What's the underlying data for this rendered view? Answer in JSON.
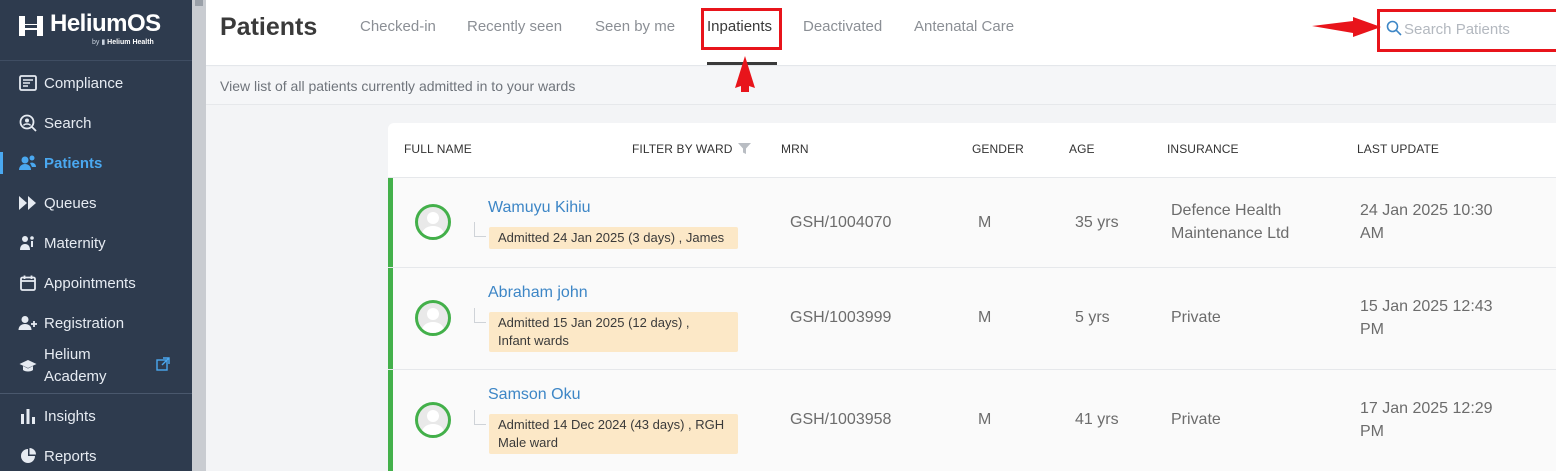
{
  "sidebar": {
    "brand": {
      "name": "HeliumOS",
      "sub_prefix": "by",
      "sub_brand": "Helium Health"
    },
    "items": [
      {
        "label": "Compliance",
        "icon": "compliance-icon"
      },
      {
        "label": "Search",
        "icon": "search-icon"
      },
      {
        "label": "Patients",
        "icon": "patients-icon",
        "active": true
      },
      {
        "label": "Queues",
        "icon": "queues-icon"
      },
      {
        "label": "Maternity",
        "icon": "maternity-icon"
      },
      {
        "label": "Appointments",
        "icon": "calendar-icon"
      },
      {
        "label": "Registration",
        "icon": "add-user-icon"
      },
      {
        "label": "Helium Academy",
        "label_line1": "Helium",
        "label_line2": "Academy",
        "icon": "graduation-cap-icon",
        "external_icon": "external-link-icon"
      },
      {
        "label": "Insights",
        "icon": "bar-chart-icon"
      },
      {
        "label": "Reports",
        "icon": "pie-chart-icon"
      }
    ]
  },
  "header": {
    "title": "Patients",
    "tabs": [
      {
        "label": "Checked-in"
      },
      {
        "label": "Recently seen"
      },
      {
        "label": "Seen by me"
      },
      {
        "label": "Inpatients",
        "active": true
      },
      {
        "label": "Deactivated"
      },
      {
        "label": "Antenatal Care"
      }
    ],
    "search": {
      "placeholder": "Search Patients",
      "value": ""
    }
  },
  "subheader": {
    "text": "View list of all patients currently admitted in to your wards"
  },
  "table": {
    "columns": {
      "full_name": "FULL NAME",
      "filter_by_ward": "FILTER BY WARD",
      "mrn": "MRN",
      "gender": "GENDER",
      "age": "AGE",
      "insurance": "INSURANCE",
      "last_update": "LAST UPDATE"
    },
    "rows": [
      {
        "name": "Wamuyu Kihiu",
        "admission": "Admitted 24 Jan 2025 (3 days) , James",
        "mrn": "GSH/1004070",
        "gender": "M",
        "age": "35 yrs",
        "insurance_line1": "Defence Health",
        "insurance_line2": "Maintenance Ltd",
        "last_update_line1": "24 Jan 2025 10:30",
        "last_update_line2": "AM"
      },
      {
        "name": "Abraham john",
        "admission_line1": "Admitted 15 Jan 2025 (12 days) ,",
        "admission_line2": "Infant wards",
        "mrn": "GSH/1003999",
        "gender": "M",
        "age": "5 yrs",
        "insurance_line1": "Private",
        "last_update_line1": "15 Jan 2025 12:43",
        "last_update_line2": "PM"
      },
      {
        "name": "Samson Oku",
        "admission_line1": "Admitted 14 Dec 2024 (43 days) , RGH",
        "admission_line2": "Male ward",
        "mrn": "GSH/1003958",
        "gender": "M",
        "age": "41 yrs",
        "insurance_line1": "Private",
        "last_update_line1": "17 Jan 2025 12:29",
        "last_update_line2": "PM"
      }
    ]
  },
  "colors": {
    "sidebar_bg": "#2e3b4e",
    "accent_blue": "#4aa8f0",
    "link_blue": "#3d86c6",
    "status_green": "#43b04a",
    "admission_badge": "#fce8c7",
    "annotation_red": "#e8141b"
  }
}
